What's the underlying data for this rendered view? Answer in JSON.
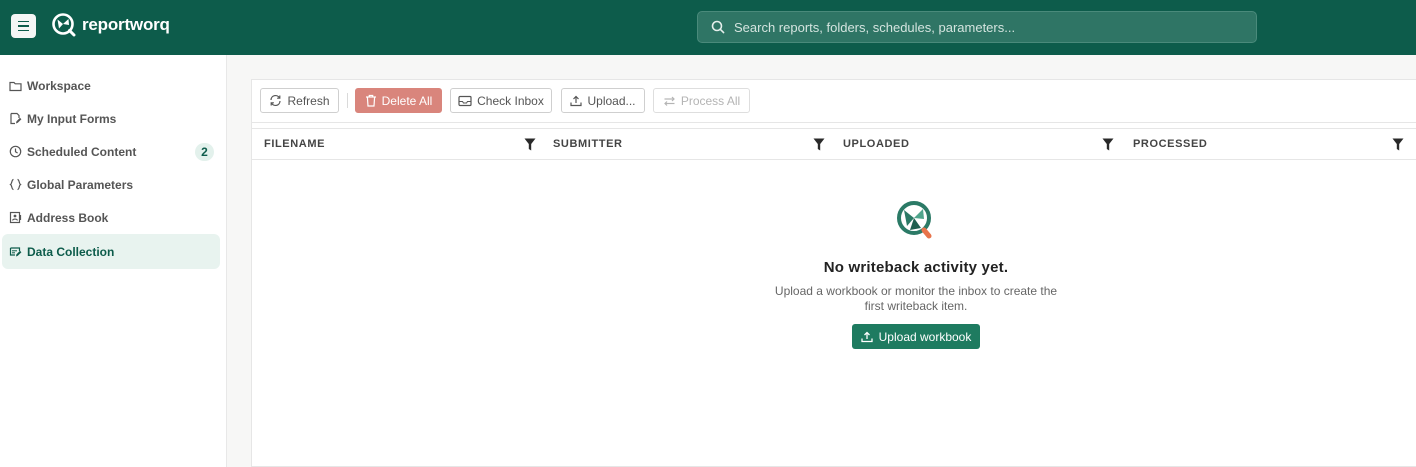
{
  "app": {
    "name": "reportworq"
  },
  "search": {
    "placeholder": "Search reports, folders, schedules, parameters..."
  },
  "sidebar": {
    "items": [
      {
        "label": "Workspace",
        "icon": "folder-icon"
      },
      {
        "label": "My Input Forms",
        "icon": "form-edit-icon"
      },
      {
        "label": "Scheduled Content",
        "icon": "clock-icon",
        "badge": "2"
      },
      {
        "label": "Global Parameters",
        "icon": "braces-icon"
      },
      {
        "label": "Address Book",
        "icon": "contact-card-icon"
      },
      {
        "label": "Data Collection",
        "icon": "data-edit-icon",
        "active": true
      }
    ]
  },
  "toolbar": {
    "refresh": "Refresh",
    "delete_all": "Delete All",
    "check_inbox": "Check Inbox",
    "upload": "Upload...",
    "process_all": "Process All"
  },
  "table": {
    "columns": [
      "FILENAME",
      "SUBMITTER",
      "UPLOADED",
      "PROCESSED"
    ]
  },
  "empty_state": {
    "title": "No writeback activity yet.",
    "text": "Upload a workbook or monitor the inbox to create the first writeback item.",
    "button": "Upload workbook"
  },
  "colors": {
    "header": "#0d5c4b",
    "accent": "#1e7b60",
    "danger": "#d9857c",
    "logo_orange": "#e8734a"
  }
}
